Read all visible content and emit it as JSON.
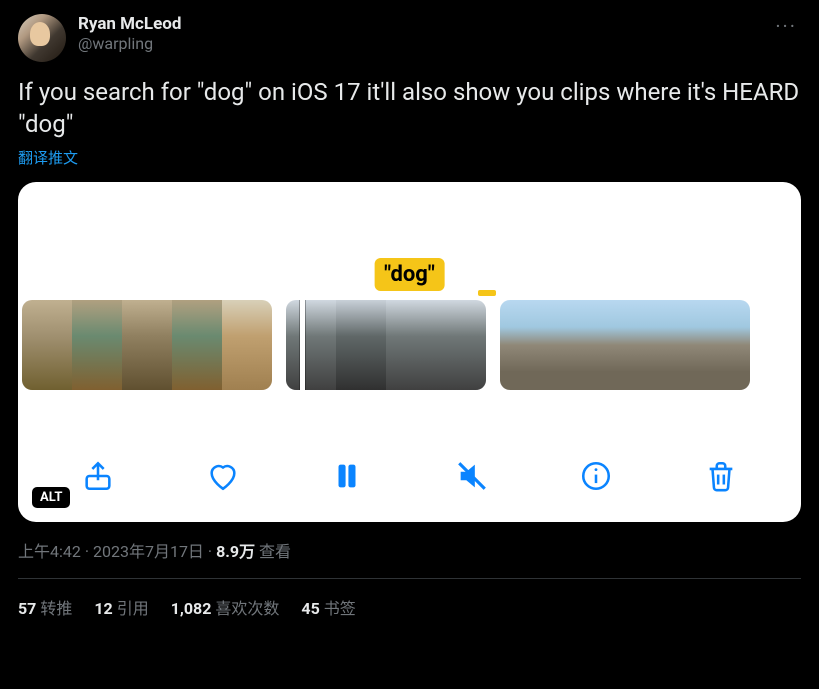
{
  "user": {
    "display_name": "Ryan McLeod",
    "handle": "@warpling"
  },
  "tweet": {
    "text": "If you search for \"dog\" on iOS 17 it'll also show you clips where it's HEARD \"dog\"",
    "translate_label": "翻译推文",
    "caption_text": "\"dog\"",
    "alt_badge": "ALT"
  },
  "meta": {
    "time": "上午4:42",
    "date": "2023年7月17日",
    "sep": " · ",
    "views_num": "8.9万",
    "views_label": " 查看"
  },
  "stats": {
    "retweets_num": "57",
    "retweets_label": "转推",
    "quotes_num": "12",
    "quotes_label": "引用",
    "likes_num": "1,082",
    "likes_label": "喜欢次数",
    "bookmarks_num": "45",
    "bookmarks_label": "书签"
  },
  "icons": {
    "more": "···"
  }
}
